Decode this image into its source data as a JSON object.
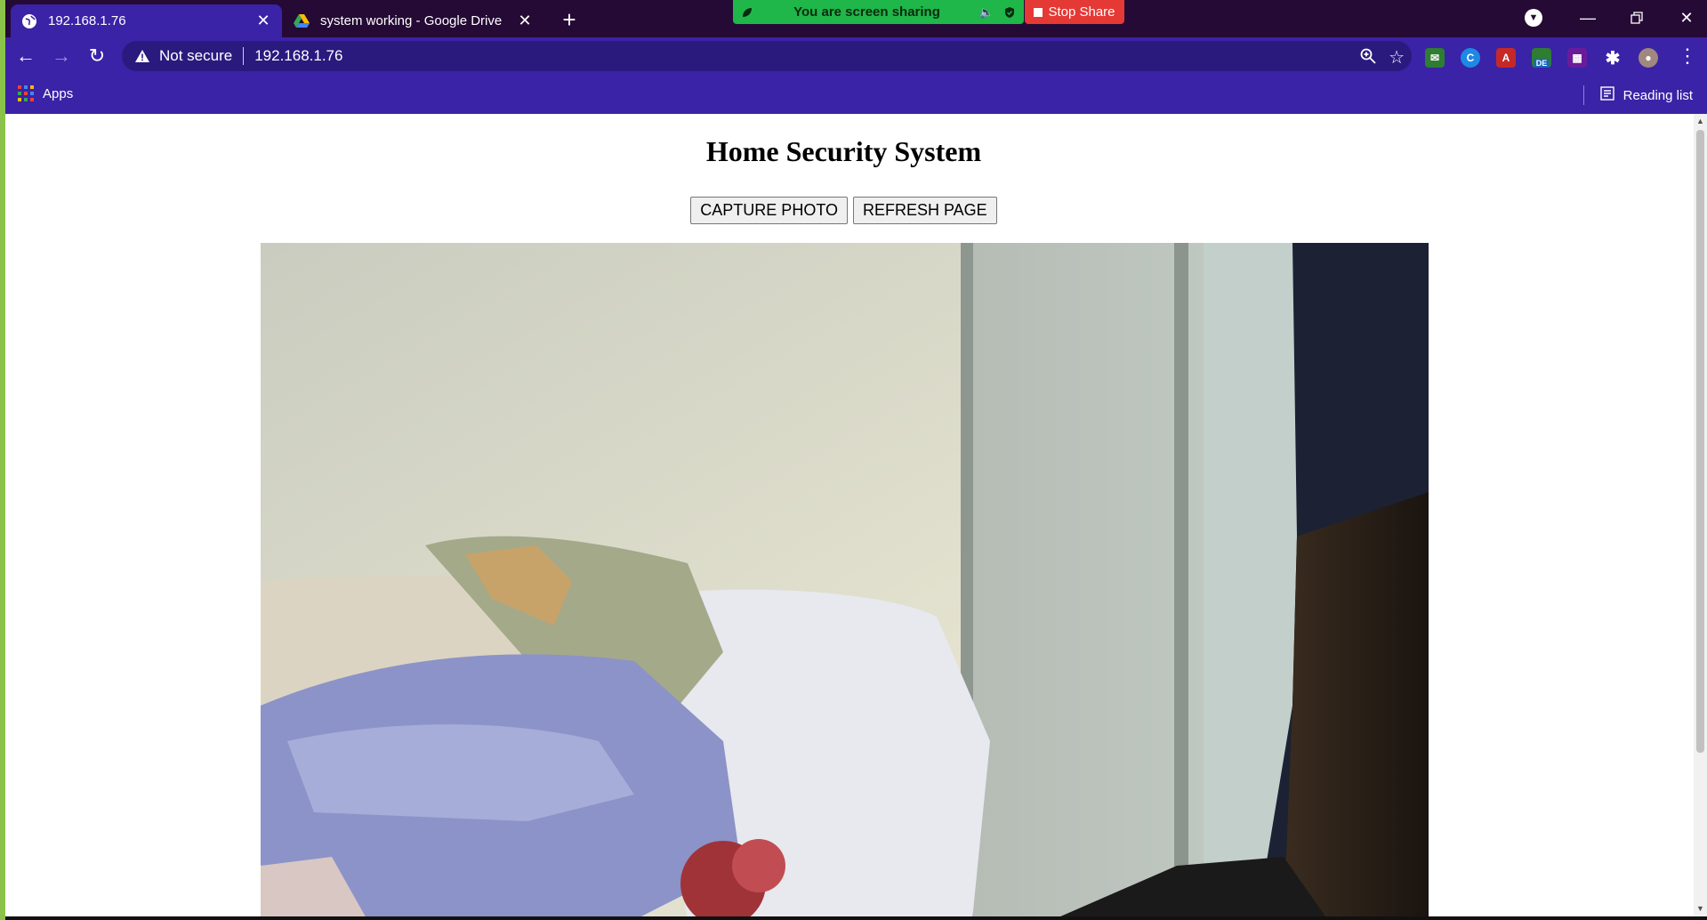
{
  "browser": {
    "tabs": [
      {
        "label": "192.168.1.76",
        "active": true,
        "favicon": "globe-icon"
      },
      {
        "label": "system working - Google Drive",
        "active": false,
        "favicon": "google-drive-icon"
      }
    ],
    "new_tab": "+",
    "share_bar": {
      "text": "You are screen sharing",
      "stop_label": "Stop Share"
    },
    "address": {
      "security": "Not secure",
      "url": "192.168.1.76"
    },
    "bookmarks": {
      "apps_label": "Apps",
      "reading_list_label": "Reading list"
    },
    "extensions": [
      "mail-extension-icon",
      "c-extension-icon",
      "pdf-extension-icon",
      "de-extension-icon",
      "pattern-extension-icon",
      "puzzle-icon",
      "profile-avatar"
    ],
    "ext_de_badge": "DE",
    "accent": "#3a23a6"
  },
  "page": {
    "title": "Home Security System",
    "capture_label": "CAPTURE PHOTO",
    "refresh_label": "REFRESH PAGE"
  }
}
